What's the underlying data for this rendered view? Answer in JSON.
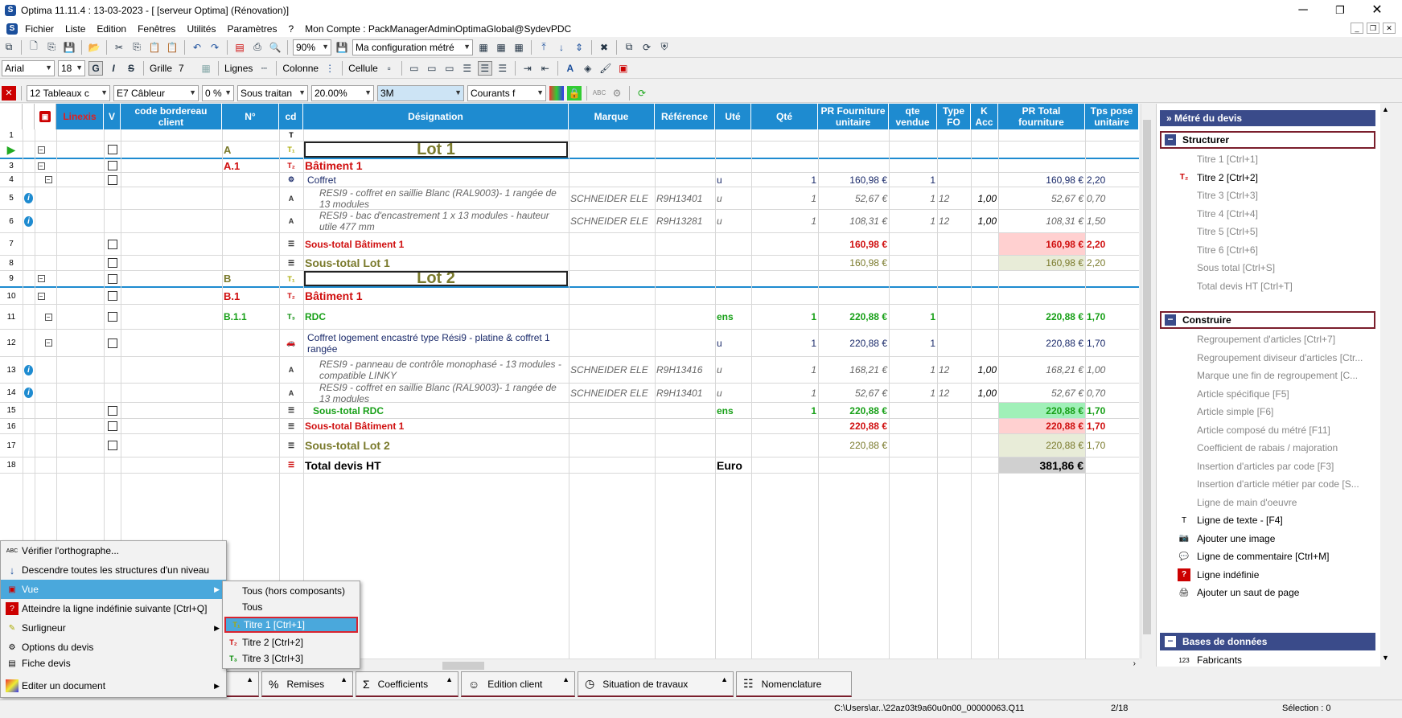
{
  "window": {
    "title": "Optima 11.11.4 : 13-03-2023 - [ [serveur Optima] (Rénovation)]",
    "minimize": "─",
    "maximize": "❐",
    "close": "✕"
  },
  "menu": [
    "Fichier",
    "Liste",
    "Edition",
    "Fenêtres",
    "Utilités",
    "Paramètres",
    "?",
    "Mon Compte : PackManagerAdminOptimaGlobal@SydevPDC"
  ],
  "toolbar1": {
    "zoom": "90%",
    "config": "Ma configuration métré"
  },
  "toolbar2": {
    "font": "Arial",
    "size": "18",
    "bold": "G",
    "italic": "I",
    "strike": "S",
    "grille": "Grille",
    "grille_val": "7",
    "lignes": "Lignes",
    "colonne": "Colonne",
    "cellule": "Cellule"
  },
  "toolbar3": {
    "tableaux": "12  Tableaux c",
    "cableur": "E7  Câbleur",
    "pct": "0 %",
    "sous_traitant": "Sous traitan",
    "rate": "20.00%",
    "brand": "3M",
    "courants": "Courants f"
  },
  "columns": {
    "linexis": "Linexis",
    "v": "V",
    "code": "code bordereau client",
    "num": "N°",
    "cd": "cd",
    "designation": "Désignation",
    "marque": "Marque",
    "reference": "Référence",
    "ute": "Uté",
    "qte": "Qté",
    "pr_fourn": "PR Fourniture unitaire",
    "qte_vendue": "qte vendue",
    "type_fo": "Type FO",
    "k_acc": "K Acc",
    "pr_total": "PR Total fourniture",
    "tps_pose": "Tps pose unitaire"
  },
  "rows": [
    {
      "n": "1",
      "num": "",
      "des": "",
      "tree": "",
      "chk": false
    },
    {
      "n": "",
      "num": "A",
      "des": "Lot 1",
      "kind": "lot",
      "tree": "⊟",
      "chk": true
    },
    {
      "n": "3",
      "num": "A.1",
      "des": "Bâtiment 1",
      "kind": "bat",
      "tree": "⊟",
      "chk": true
    },
    {
      "n": "4",
      "num": "",
      "des": "Coffret",
      "kind": "art",
      "tree": "⊟",
      "chk": true,
      "ute": "u",
      "qte": "1",
      "pr": "160,98 €",
      "qv": "1",
      "prt": "160,98 €",
      "tps": "2,20"
    },
    {
      "n": "5",
      "num": "",
      "des": "RESI9 - coffret en saillie Blanc (RAL9003)- 1 rangée de 13 modules",
      "kind": "sub",
      "info": true,
      "marque": "SCHNEIDER ELE",
      "ref": "R9H13401",
      "ute": "u",
      "qte": "1",
      "pr": "52,67 €",
      "qv": "1",
      "fo": "12",
      "k": "1,00",
      "prt": "52,67 €",
      "tps": "0,70"
    },
    {
      "n": "6",
      "num": "",
      "des": "RESI9 - bac d'encastrement 1 x 13 modules - hauteur utile 477 mm",
      "kind": "sub",
      "info": true,
      "marque": "SCHNEIDER ELE",
      "ref": "R9H13281",
      "ute": "u",
      "qte": "1",
      "pr": "108,31 €",
      "qv": "1",
      "fo": "12",
      "k": "1,00",
      "prt": "108,31 €",
      "tps": "1,50"
    },
    {
      "n": "7",
      "num": "",
      "des": "Sous-total Bâtiment 1",
      "kind": "stbat",
      "chk": true,
      "pr": "160,98 €",
      "prt": "160,98 €",
      "tps": "2,20"
    },
    {
      "n": "8",
      "num": "",
      "des": "Sous-total Lot 1",
      "kind": "stlot",
      "chk": true,
      "pr": "160,98 €",
      "prt": "160,98 €",
      "tps": "2,20"
    },
    {
      "n": "9",
      "num": "B",
      "des": "Lot 2",
      "kind": "lot",
      "tree": "⊟",
      "chk": true
    },
    {
      "n": "10",
      "num": "B.1",
      "des": "Bâtiment 1",
      "kind": "bat",
      "tree": "⊟",
      "chk": true
    },
    {
      "n": "11",
      "num": "B.1.1",
      "des": "RDC",
      "kind": "rdc",
      "tree": "⊟",
      "chk": true,
      "ute": "ens",
      "qte": "1",
      "pr": "220,88 €",
      "qv": "1",
      "prt": "220,88 €",
      "tps": "1,70"
    },
    {
      "n": "12",
      "num": "",
      "des": "Coffret logement encastré type Rési9 - platine & coffret 1 rangée",
      "kind": "art2",
      "tree": "⊟",
      "chk": true,
      "ute": "u",
      "qte": "1",
      "pr": "220,88 €",
      "qv": "1",
      "prt": "220,88 €",
      "tps": "1,70"
    },
    {
      "n": "13",
      "num": "",
      "des": "RESI9 - panneau de contrôle monophasé - 13 modules - compatible LINKY",
      "kind": "sub",
      "info": true,
      "marque": "SCHNEIDER ELE",
      "ref": "R9H13416",
      "ute": "u",
      "qte": "1",
      "pr": "168,21 €",
      "qv": "1",
      "fo": "12",
      "k": "1,00",
      "prt": "168,21 €",
      "tps": "1,00"
    },
    {
      "n": "14",
      "num": "",
      "des": "RESI9 - coffret en saillie Blanc (RAL9003)- 1 rangée de 13 modules",
      "kind": "sub",
      "info": true,
      "marque": "SCHNEIDER ELE",
      "ref": "R9H13401",
      "ute": "u",
      "qte": "1",
      "pr": "52,67 €",
      "qv": "1",
      "fo": "12",
      "k": "1,00",
      "prt": "52,67 €",
      "tps": "0,70"
    },
    {
      "n": "15",
      "num": "",
      "des": "Sous-total RDC",
      "kind": "strdc",
      "chk": true,
      "ute": "ens",
      "qte": "1",
      "pr": "220,88 €",
      "prt": "220,88 €",
      "tps": "1,70"
    },
    {
      "n": "16",
      "num": "",
      "des": "Sous-total Bâtiment 1",
      "kind": "stbat",
      "chk": true,
      "pr": "220,88 €",
      "prt": "220,88 €",
      "tps": "1,70"
    },
    {
      "n": "17",
      "num": "",
      "des": "Sous-total Lot 2",
      "kind": "stlot",
      "chk": true,
      "pr": "220,88 €",
      "prt": "220,88 €",
      "tps": "1,70"
    },
    {
      "n": "18",
      "num": "",
      "des": "Total devis HT",
      "kind": "total",
      "ute": "Euro",
      "prt": "381,86 €"
    }
  ],
  "panel": {
    "title": "Métré du devis",
    "structurer": "Structurer",
    "structurer_items": [
      "Titre 1 [Ctrl+1]",
      "Titre 2 [Ctrl+2]",
      "Titre 3 [Ctrl+3]",
      "Titre 4 [Ctrl+4]",
      "Titre 5 [Ctrl+5]",
      "Titre 6 [Ctrl+6]",
      "Sous total [Ctrl+S]",
      "Total devis HT [Ctrl+T]"
    ],
    "construire": "Construire",
    "construire_items": [
      "Regroupement d'articles  [Ctrl+7]",
      "Regroupement diviseur d'articles [Ctr...",
      "Marque une fin de regroupement  [C...",
      "Article spécifique [F5]",
      "Article simple [F6]",
      "Article composé du métré [F11]",
      "Coefficient de rabais / majoration",
      "Insertion d'articles par code [F3]",
      "Insertion d'article métier par code [S...",
      "Ligne de main d'oeuvre",
      "Ligne de texte - [F4]",
      "Ajouter une image",
      "Ligne de commentaire [Ctrl+M]",
      "Ligne indéfinie",
      "Ajouter un saut de page"
    ],
    "bases": "Bases de données",
    "bases_items": [
      "Fabricants"
    ]
  },
  "context_menu": [
    "Vérifier l'orthographe...",
    "Descendre toutes les structures d'un niveau",
    "Vue",
    "Atteindre la ligne indéfinie suivante [Ctrl+Q]",
    "Surligneur",
    "Options du devis",
    "Fiche devis",
    "Editer un document"
  ],
  "submenu": [
    "Tous (hors composants)",
    "Tous",
    "Titre 1 [Ctrl+1]",
    "Titre 2 [Ctrl+2]",
    "Titre 3 [Ctrl+3]"
  ],
  "tabs": [
    "Remises",
    "Coefficients",
    "Edition client",
    "Situation de travaux",
    "Nomenclature"
  ],
  "status": {
    "path": "C:\\Users\\ar..\\22az03t9a60u0n00_00000063.Q11",
    "page": "2/18",
    "selection": "Sélection : 0"
  }
}
